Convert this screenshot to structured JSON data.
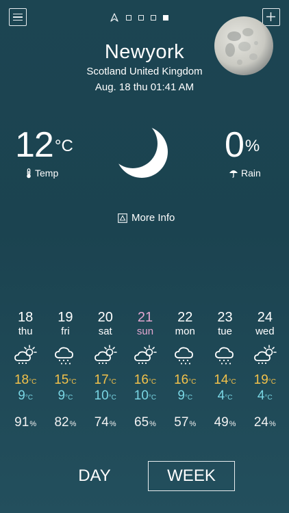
{
  "header": {
    "menu_icon": "hamburger-menu-icon",
    "location_icon": "location-arrow-icon",
    "add_icon": "plus-icon",
    "page_indicator": {
      "total": 4,
      "active_index": 3
    }
  },
  "location": {
    "city": "Newyork",
    "region": "Scotland United Kingdom",
    "datetime": "Aug. 18 thu 01:41 AM"
  },
  "current": {
    "temp_value": "12",
    "temp_unit": "°C",
    "temp_label": "Temp",
    "rain_value": "0",
    "rain_unit": "%",
    "rain_label": "Rain",
    "condition_icon": "crescent-moon-icon",
    "more_info_label": "More Info"
  },
  "forecast": {
    "deg_unit": "°C",
    "pct_unit": "%",
    "days": [
      {
        "date": "18",
        "day": "thu",
        "icon": "partly-cloudy-icon",
        "high": "18",
        "low": "9",
        "humidity": "91"
      },
      {
        "date": "19",
        "day": "fri",
        "icon": "cloud-rain-icon",
        "high": "15",
        "low": "9",
        "humidity": "82"
      },
      {
        "date": "20",
        "day": "sat",
        "icon": "partly-cloudy-icon",
        "high": "17",
        "low": "10",
        "humidity": "74"
      },
      {
        "date": "21",
        "day": "sun",
        "icon": "partly-cloudy-icon",
        "high": "16",
        "low": "10",
        "humidity": "65"
      },
      {
        "date": "22",
        "day": "mon",
        "icon": "cloud-rain-icon",
        "high": "16",
        "low": "9",
        "humidity": "57"
      },
      {
        "date": "23",
        "day": "tue",
        "icon": "cloud-rain-icon",
        "high": "14",
        "low": "4",
        "humidity": "49"
      },
      {
        "date": "24",
        "day": "wed",
        "icon": "partly-cloudy-icon",
        "high": "19",
        "low": "4",
        "humidity": "24"
      }
    ]
  },
  "view_toggle": {
    "day_label": "DAY",
    "week_label": "WEEK",
    "selected": "WEEK"
  },
  "colors": {
    "background": "#1c4552",
    "high_temp": "#f3c24a",
    "low_temp": "#7ad6e4",
    "sunday": "#e3a7d0"
  }
}
